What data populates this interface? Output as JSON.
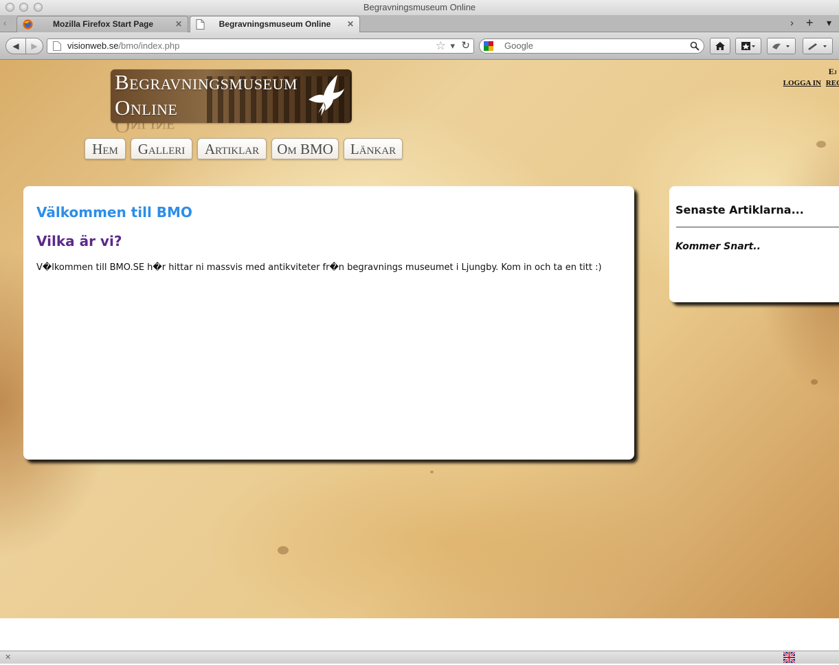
{
  "window": {
    "title": "Begravningsmuseum Online"
  },
  "tabs": [
    {
      "label": "Mozilla Firefox Start Page",
      "close": "✕"
    },
    {
      "label": "Begravningsmuseum Online",
      "close": "✕"
    }
  ],
  "toolbar": {
    "back": "◀",
    "forward": "▶",
    "url_host": "visionweb.se",
    "url_path": "/bmo/index.php",
    "bookmark_star": "☆",
    "dropdown": "▾",
    "reload": "↻",
    "search_placeholder": "Google",
    "search_icon": "search-icon",
    "tab_scroll": "›",
    "new_tab": "+",
    "tab_list": "▾"
  },
  "page": {
    "logo": {
      "line1": "Begravningsmuseum",
      "line2": "Online"
    },
    "nav": [
      {
        "label": "Hem"
      },
      {
        "label": "Galleri"
      },
      {
        "label": "Artiklar"
      },
      {
        "label": "Om BMO"
      },
      {
        "label": "Länkar"
      }
    ],
    "login_status": {
      "line1": "Ej inl",
      "login": "LOGGA IN",
      "register": "REGIS"
    },
    "main": {
      "welcome": "Välkommen till BMO",
      "who_heading": "Vilka är vi?",
      "body": "V�lkommen till BMO.SE h�r hittar ni massvis med antikviteter fr�n begravnings museumet i Ljungby. Kom in och ta en titt :)"
    },
    "sidebar": {
      "title": "Senaste Artiklarna...",
      "note": "Kommer Snart.."
    }
  },
  "statusbar": {
    "close": "✕"
  }
}
